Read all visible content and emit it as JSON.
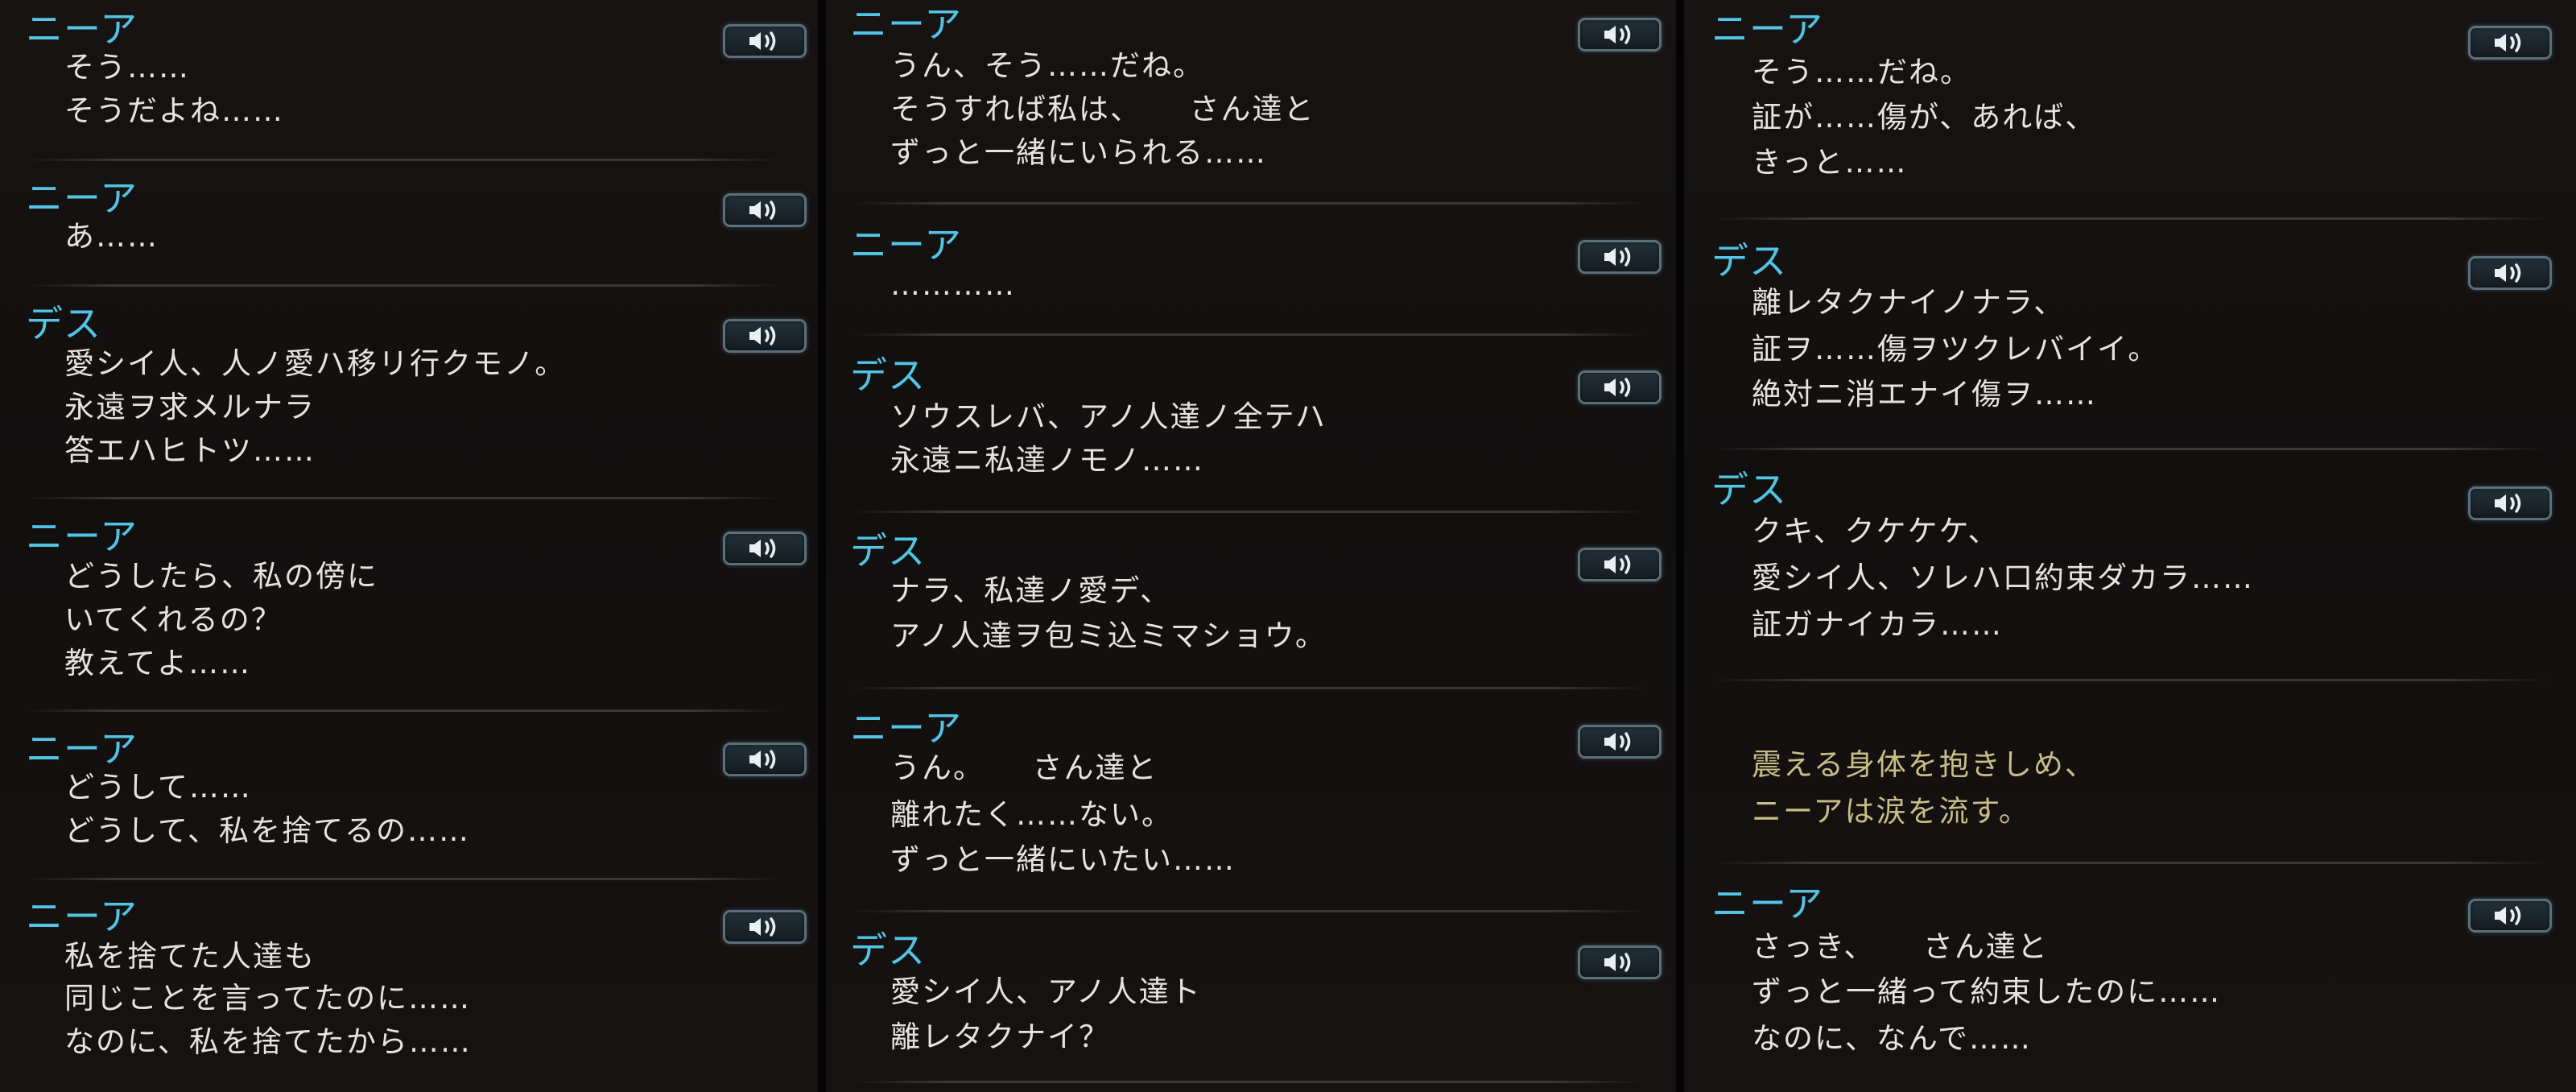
{
  "ui": {
    "voice_icon": "speaker-voice-icon",
    "colors": {
      "speaker": "#52c4e4",
      "text": "#e6e2dc",
      "narration": "#c7bd86",
      "background": "#120f0f"
    }
  },
  "columns": [
    {
      "entries": [
        {
          "speaker": "ニーア",
          "lines": [
            "そう……",
            "そうだよね……"
          ]
        },
        {
          "speaker": "ニーア",
          "lines": [
            "あ……"
          ]
        },
        {
          "speaker": "デス",
          "lines": [
            "愛シイ人、人ノ愛ハ移リ行クモノ。",
            "永遠ヲ求メルナラ",
            "答エハヒトツ……"
          ]
        },
        {
          "speaker": "ニーア",
          "lines": [
            "どうしたら、私の傍に",
            "いてくれるの？",
            "教えてよ……"
          ]
        },
        {
          "speaker": "ニーア",
          "lines": [
            "どうして……",
            "どうして、私を捨てるの……"
          ]
        },
        {
          "speaker": "ニーア",
          "lines": [
            "私を捨てた人達も",
            "同じことを言ってたのに……",
            "なのに、私を捨てたから……"
          ]
        }
      ]
    },
    {
      "entries": [
        {
          "speaker": "ニーア",
          "lines": [
            "うん、そう……だね。",
            "そうすれば私は、　　さん達と",
            "ずっと一緒にいられる……"
          ]
        },
        {
          "speaker": "ニーア",
          "lines": [
            "…………"
          ]
        },
        {
          "speaker": "デス",
          "lines": [
            "ソウスレバ、アノ人達ノ全テハ",
            "永遠ニ私達ノモノ……"
          ]
        },
        {
          "speaker": "デス",
          "lines": [
            "ナラ、私達ノ愛デ、",
            "アノ人達ヲ包ミ込ミマショウ。"
          ]
        },
        {
          "speaker": "ニーア",
          "lines": [
            "うん。　　さん達と",
            "離れたく……ない。",
            "ずっと一緒にいたい……"
          ]
        },
        {
          "speaker": "デス",
          "lines": [
            "愛シイ人、アノ人達ト",
            "離レタクナイ？"
          ]
        }
      ]
    },
    {
      "entries": [
        {
          "speaker": "ニーア",
          "lines": [
            "そう……だね。",
            "証が……傷が、あれば、",
            "きっと……"
          ]
        },
        {
          "speaker": "デス",
          "lines": [
            "離レタクナイノナラ、",
            "証ヲ……傷ヲツクレバイイ。",
            "絶対ニ消エナイ傷ヲ……"
          ]
        },
        {
          "speaker": "デス",
          "lines": [
            "クキ、クケケケ、",
            "愛シイ人、ソレハ口約束ダカラ……",
            "証ガナイカラ……"
          ]
        },
        {
          "speaker": "",
          "lines": [
            "震える身体を抱きしめ、",
            "ニーアは涙を流す。"
          ]
        },
        {
          "speaker": "ニーア",
          "lines": [
            "さっき、　　さん達と",
            "ずっと一緒って約束したのに……",
            "なのに、なんで……"
          ]
        }
      ]
    }
  ]
}
